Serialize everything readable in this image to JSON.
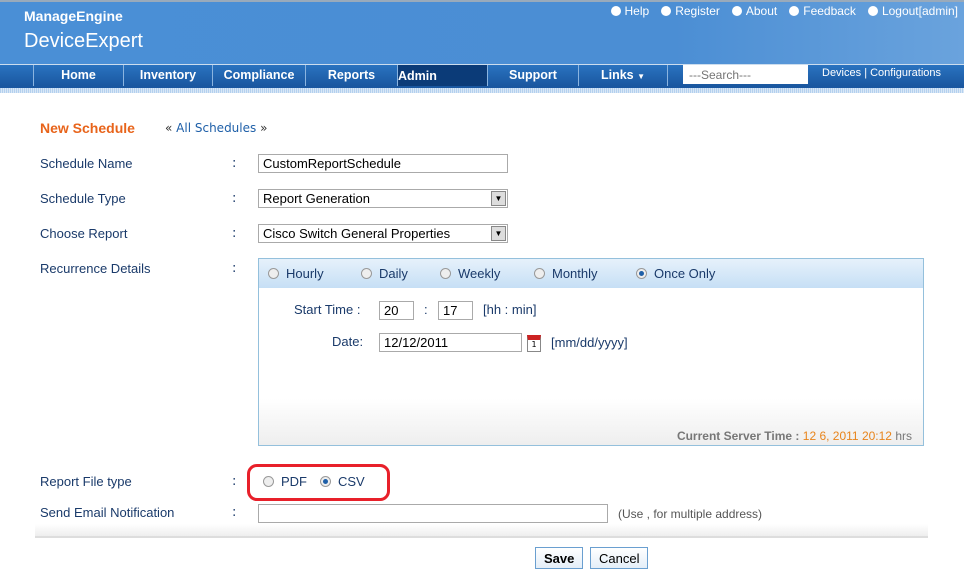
{
  "header": {
    "brand": "ManageEngine",
    "product": "DeviceExpert",
    "links": [
      {
        "label": "Help",
        "icon": "help-icon"
      },
      {
        "label": "Register",
        "icon": "register-icon"
      },
      {
        "label": "About",
        "icon": "info-icon"
      },
      {
        "label": "Feedback",
        "icon": "feedback-icon"
      },
      {
        "label": "Logout[admin]",
        "icon": "logout-icon"
      }
    ]
  },
  "nav": {
    "tabs": [
      "Home",
      "Inventory",
      "Compliance",
      "Reports",
      "Admin",
      "Support",
      "Links"
    ],
    "active": "Admin",
    "search_placeholder": "---Search---",
    "devices": "Devices",
    "configurations": "Configurations",
    "sep": "|"
  },
  "page": {
    "title": "New Schedule",
    "crumb_prefix": "«",
    "crumb_link": "All Schedules",
    "crumb_suffix": "»"
  },
  "form": {
    "colon": ":",
    "schedule_name": {
      "label": "Schedule Name",
      "value": "CustomReportSchedule"
    },
    "schedule_type": {
      "label": "Schedule Type",
      "value": "Report Generation"
    },
    "choose_report": {
      "label": "Choose Report",
      "value": "Cisco Switch General Properties"
    },
    "recurrence": {
      "label": "Recurrence Details",
      "options": [
        "Hourly",
        "Daily",
        "Weekly",
        "Monthly",
        "Once Only"
      ],
      "selected": "Once Only",
      "start_time_label": "Start Time :",
      "hh": "20",
      "sep": ":",
      "mm": "17",
      "time_hint": "[hh : min]",
      "date_label": "Date:",
      "date": "12/12/2011",
      "date_hint": "[mm/dd/yyyy]",
      "server_time_label": "Current Server Time :",
      "server_time": "12 6, 2011 20:12",
      "server_time_unit": "hrs"
    },
    "file_type": {
      "label": "Report File type",
      "options": [
        "PDF",
        "CSV"
      ],
      "selected": "CSV"
    },
    "email": {
      "label": "Send Email Notification",
      "value": "",
      "hint": "(Use , for multiple address)"
    }
  },
  "buttons": {
    "save": "Save",
    "cancel": "Cancel"
  },
  "colors": {
    "header": "#4a8fd6",
    "nav": "#1a57a0",
    "active_tab": "#0b3b78",
    "title": "#e8641b",
    "highlight": "#e8202a"
  }
}
